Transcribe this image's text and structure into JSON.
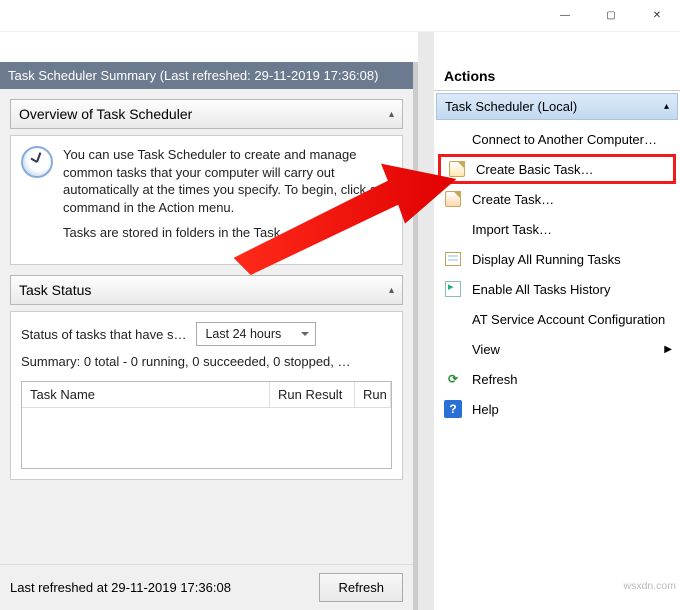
{
  "window": {
    "minimize": "—",
    "maximize": "▢",
    "close": "✕"
  },
  "main": {
    "summary_header": "Task Scheduler Summary (Last refreshed: 29-11-2019 17:36:08)",
    "overview_title": "Overview of Task Scheduler",
    "overview_text1": "You can use Task Scheduler to create and manage common tasks that your computer will carry out automatically at the times you specify. To begin, click a command in the Action menu.",
    "overview_text2": "Tasks are stored in folders in the Task",
    "status_title": "Task Status",
    "status_label": "Status of tasks that have s…",
    "status_period": "Last 24 hours",
    "status_summary": "Summary: 0 total - 0 running, 0 succeeded, 0 stopped, …",
    "col_name": "Task Name",
    "col_result": "Run Result",
    "col_run": "Run",
    "last_refreshed": "Last refreshed at 29-11-2019 17:36:08",
    "refresh_btn": "Refresh"
  },
  "actions": {
    "pane_title": "Actions",
    "group_title": "Task Scheduler (Local)",
    "items": {
      "connect": "Connect to Another Computer…",
      "create_basic": "Create Basic Task…",
      "create_task": "Create Task…",
      "import_task": "Import Task…",
      "display_running": "Display All Running Tasks",
      "enable_history": "Enable All Tasks History",
      "at_service": "AT Service Account Configuration",
      "view": "View",
      "refresh": "Refresh",
      "help": "Help"
    }
  },
  "watermark": "wsxdn.com"
}
